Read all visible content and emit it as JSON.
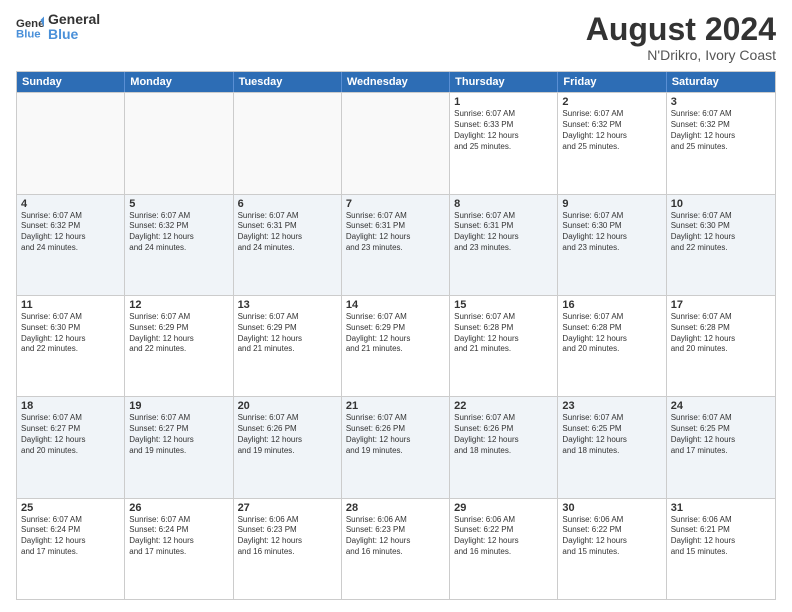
{
  "header": {
    "logo_line1": "General",
    "logo_line2": "Blue",
    "title": "August 2024",
    "subtitle": "N'Drikro, Ivory Coast"
  },
  "days_of_week": [
    "Sunday",
    "Monday",
    "Tuesday",
    "Wednesday",
    "Thursday",
    "Friday",
    "Saturday"
  ],
  "weeks": [
    [
      {
        "day": "",
        "text": "",
        "empty": true
      },
      {
        "day": "",
        "text": "",
        "empty": true
      },
      {
        "day": "",
        "text": "",
        "empty": true
      },
      {
        "day": "",
        "text": "",
        "empty": true
      },
      {
        "day": "1",
        "text": "Sunrise: 6:07 AM\nSunset: 6:33 PM\nDaylight: 12 hours\nand 25 minutes."
      },
      {
        "day": "2",
        "text": "Sunrise: 6:07 AM\nSunset: 6:32 PM\nDaylight: 12 hours\nand 25 minutes."
      },
      {
        "day": "3",
        "text": "Sunrise: 6:07 AM\nSunset: 6:32 PM\nDaylight: 12 hours\nand 25 minutes."
      }
    ],
    [
      {
        "day": "4",
        "text": "Sunrise: 6:07 AM\nSunset: 6:32 PM\nDaylight: 12 hours\nand 24 minutes."
      },
      {
        "day": "5",
        "text": "Sunrise: 6:07 AM\nSunset: 6:32 PM\nDaylight: 12 hours\nand 24 minutes."
      },
      {
        "day": "6",
        "text": "Sunrise: 6:07 AM\nSunset: 6:31 PM\nDaylight: 12 hours\nand 24 minutes."
      },
      {
        "day": "7",
        "text": "Sunrise: 6:07 AM\nSunset: 6:31 PM\nDaylight: 12 hours\nand 23 minutes."
      },
      {
        "day": "8",
        "text": "Sunrise: 6:07 AM\nSunset: 6:31 PM\nDaylight: 12 hours\nand 23 minutes."
      },
      {
        "day": "9",
        "text": "Sunrise: 6:07 AM\nSunset: 6:30 PM\nDaylight: 12 hours\nand 23 minutes."
      },
      {
        "day": "10",
        "text": "Sunrise: 6:07 AM\nSunset: 6:30 PM\nDaylight: 12 hours\nand 22 minutes."
      }
    ],
    [
      {
        "day": "11",
        "text": "Sunrise: 6:07 AM\nSunset: 6:30 PM\nDaylight: 12 hours\nand 22 minutes."
      },
      {
        "day": "12",
        "text": "Sunrise: 6:07 AM\nSunset: 6:29 PM\nDaylight: 12 hours\nand 22 minutes."
      },
      {
        "day": "13",
        "text": "Sunrise: 6:07 AM\nSunset: 6:29 PM\nDaylight: 12 hours\nand 21 minutes."
      },
      {
        "day": "14",
        "text": "Sunrise: 6:07 AM\nSunset: 6:29 PM\nDaylight: 12 hours\nand 21 minutes."
      },
      {
        "day": "15",
        "text": "Sunrise: 6:07 AM\nSunset: 6:28 PM\nDaylight: 12 hours\nand 21 minutes."
      },
      {
        "day": "16",
        "text": "Sunrise: 6:07 AM\nSunset: 6:28 PM\nDaylight: 12 hours\nand 20 minutes."
      },
      {
        "day": "17",
        "text": "Sunrise: 6:07 AM\nSunset: 6:28 PM\nDaylight: 12 hours\nand 20 minutes."
      }
    ],
    [
      {
        "day": "18",
        "text": "Sunrise: 6:07 AM\nSunset: 6:27 PM\nDaylight: 12 hours\nand 20 minutes."
      },
      {
        "day": "19",
        "text": "Sunrise: 6:07 AM\nSunset: 6:27 PM\nDaylight: 12 hours\nand 19 minutes."
      },
      {
        "day": "20",
        "text": "Sunrise: 6:07 AM\nSunset: 6:26 PM\nDaylight: 12 hours\nand 19 minutes."
      },
      {
        "day": "21",
        "text": "Sunrise: 6:07 AM\nSunset: 6:26 PM\nDaylight: 12 hours\nand 19 minutes."
      },
      {
        "day": "22",
        "text": "Sunrise: 6:07 AM\nSunset: 6:26 PM\nDaylight: 12 hours\nand 18 minutes."
      },
      {
        "day": "23",
        "text": "Sunrise: 6:07 AM\nSunset: 6:25 PM\nDaylight: 12 hours\nand 18 minutes."
      },
      {
        "day": "24",
        "text": "Sunrise: 6:07 AM\nSunset: 6:25 PM\nDaylight: 12 hours\nand 17 minutes."
      }
    ],
    [
      {
        "day": "25",
        "text": "Sunrise: 6:07 AM\nSunset: 6:24 PM\nDaylight: 12 hours\nand 17 minutes."
      },
      {
        "day": "26",
        "text": "Sunrise: 6:07 AM\nSunset: 6:24 PM\nDaylight: 12 hours\nand 17 minutes."
      },
      {
        "day": "27",
        "text": "Sunrise: 6:06 AM\nSunset: 6:23 PM\nDaylight: 12 hours\nand 16 minutes."
      },
      {
        "day": "28",
        "text": "Sunrise: 6:06 AM\nSunset: 6:23 PM\nDaylight: 12 hours\nand 16 minutes."
      },
      {
        "day": "29",
        "text": "Sunrise: 6:06 AM\nSunset: 6:22 PM\nDaylight: 12 hours\nand 16 minutes."
      },
      {
        "day": "30",
        "text": "Sunrise: 6:06 AM\nSunset: 6:22 PM\nDaylight: 12 hours\nand 15 minutes."
      },
      {
        "day": "31",
        "text": "Sunrise: 6:06 AM\nSunset: 6:21 PM\nDaylight: 12 hours\nand 15 minutes."
      }
    ]
  ]
}
